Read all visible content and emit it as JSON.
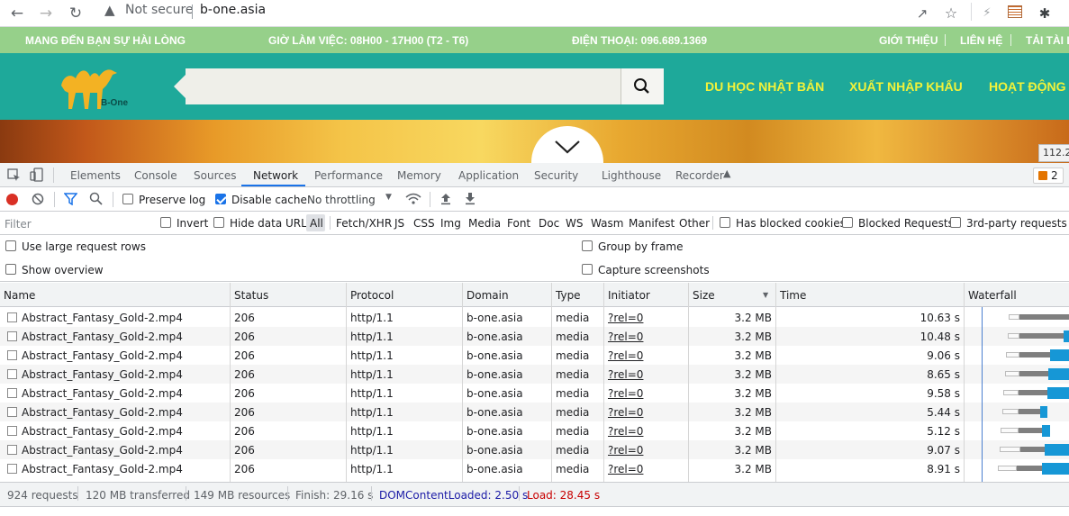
{
  "browser": {
    "security_label": "Not secure",
    "url": "b-one.asia"
  },
  "site": {
    "strip": {
      "slogan": "MANG ĐẾN BẠN SỰ HÀI LÒNG",
      "hours": "GIỜ LÀM VIỆC: 08H00 - 17H00 (T2 - T6)",
      "phone": "ĐIỆN THOẠI: 096.689.1369",
      "links": [
        "GIỚI THIỆU",
        "LIÊN HỆ",
        "TẢI TÀI LI"
      ]
    },
    "logo_text": "B-One",
    "menu": [
      "DU HỌC NHẬT BẢN",
      "XUẤT NHẬP KHẨU",
      "HOẠT ĐỘNG -"
    ],
    "size_tooltip": "112.2"
  },
  "devtools": {
    "tabs": [
      "Elements",
      "Console",
      "Sources",
      "Network",
      "Performance",
      "Memory",
      "Application",
      "Security",
      "Lighthouse",
      "Recorder"
    ],
    "active_tab": "Network",
    "issues_count": "2",
    "toolbar": {
      "preserve_log": "Preserve log",
      "disable_cache": "Disable cache",
      "throttling": "No throttling"
    },
    "filter": {
      "placeholder": "Filter",
      "invert": "Invert",
      "hide_data_urls": "Hide data URLs",
      "types": [
        "All",
        "Fetch/XHR",
        "JS",
        "CSS",
        "Img",
        "Media",
        "Font",
        "Doc",
        "WS",
        "Wasm",
        "Manifest",
        "Other"
      ],
      "blocked_cookies": "Has blocked cookies",
      "blocked_requests": "Blocked Requests",
      "third_party": "3rd-party requests"
    },
    "options": {
      "large_rows": "Use large request rows",
      "overview": "Show overview",
      "group_by_frame": "Group by frame",
      "capture_screenshots": "Capture screenshots"
    },
    "columns": [
      "Name",
      "Status",
      "Protocol",
      "Domain",
      "Type",
      "Initiator",
      "Size",
      "Time",
      "Waterfall"
    ],
    "rows": [
      {
        "name": "Abstract_Fantasy_Gold-2.mp4",
        "status": "206",
        "protocol": "http/1.1",
        "domain": "b-one.asia",
        "type": "media",
        "initiator": "?rel=0",
        "size": "3.2 MB",
        "time": "10.63 s"
      },
      {
        "name": "Abstract_Fantasy_Gold-2.mp4",
        "status": "206",
        "protocol": "http/1.1",
        "domain": "b-one.asia",
        "type": "media",
        "initiator": "?rel=0",
        "size": "3.2 MB",
        "time": "10.48 s"
      },
      {
        "name": "Abstract_Fantasy_Gold-2.mp4",
        "status": "206",
        "protocol": "http/1.1",
        "domain": "b-one.asia",
        "type": "media",
        "initiator": "?rel=0",
        "size": "3.2 MB",
        "time": "9.06 s"
      },
      {
        "name": "Abstract_Fantasy_Gold-2.mp4",
        "status": "206",
        "protocol": "http/1.1",
        "domain": "b-one.asia",
        "type": "media",
        "initiator": "?rel=0",
        "size": "3.2 MB",
        "time": "8.65 s"
      },
      {
        "name": "Abstract_Fantasy_Gold-2.mp4",
        "status": "206",
        "protocol": "http/1.1",
        "domain": "b-one.asia",
        "type": "media",
        "initiator": "?rel=0",
        "size": "3.2 MB",
        "time": "9.58 s"
      },
      {
        "name": "Abstract_Fantasy_Gold-2.mp4",
        "status": "206",
        "protocol": "http/1.1",
        "domain": "b-one.asia",
        "type": "media",
        "initiator": "?rel=0",
        "size": "3.2 MB",
        "time": "5.44 s"
      },
      {
        "name": "Abstract_Fantasy_Gold-2.mp4",
        "status": "206",
        "protocol": "http/1.1",
        "domain": "b-one.asia",
        "type": "media",
        "initiator": "?rel=0",
        "size": "3.2 MB",
        "time": "5.12 s"
      },
      {
        "name": "Abstract_Fantasy_Gold-2.mp4",
        "status": "206",
        "protocol": "http/1.1",
        "domain": "b-one.asia",
        "type": "media",
        "initiator": "?rel=0",
        "size": "3.2 MB",
        "time": "9.07 s"
      },
      {
        "name": "Abstract_Fantasy_Gold-2.mp4",
        "status": "206",
        "protocol": "http/1.1",
        "domain": "b-one.asia",
        "type": "media",
        "initiator": "?rel=0",
        "size": "3.2 MB",
        "time": "8.91 s"
      }
    ],
    "summary": {
      "requests": "924 requests",
      "transferred": "120 MB transferred",
      "resources": "149 MB resources",
      "finish": "Finish: 29.16 s",
      "dom_content_loaded": "DOMContentLoaded: 2.50 s",
      "load": "Load: 28.45 s"
    },
    "colors": {
      "accent": "#1a73e8",
      "dcl": "#1a1aa6",
      "load": "#c80000",
      "waterfall_blue": "#1697d6"
    }
  }
}
